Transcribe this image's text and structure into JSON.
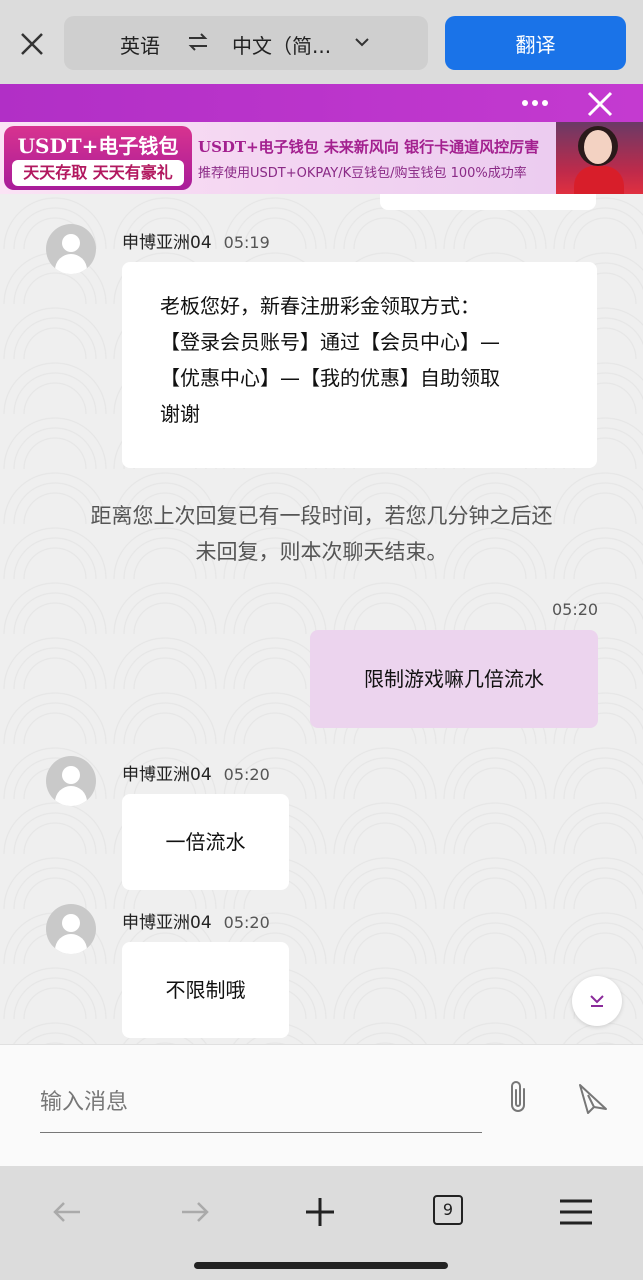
{
  "translate_bar": {
    "source_lang": "英语",
    "target_lang": "中文（简...",
    "translate_label": "翻译"
  },
  "banner": {
    "badge_title": "USDT+电子钱包",
    "badge_sub": "天天存取 天天有豪礼",
    "line1": "USDT+电子钱包 未来新风向 银行卡通道风控厉害",
    "line2": "推荐使用USDT+OKPAY/K豆钱包/购宝钱包 100%成功率"
  },
  "messages": [
    {
      "sender": "申博亚洲04",
      "time": "05:19",
      "lines": [
        "老板您好，新春注册彩金领取方式：",
        "【登录会员账号】通过【会员中心】—",
        "【优惠中心】—【我的优惠】自助领取",
        "谢谢"
      ]
    },
    {
      "sender": "申博亚洲04",
      "time": "05:20",
      "text": "一倍流水"
    },
    {
      "sender": "申博亚洲04",
      "time": "05:20",
      "text": "不限制哦"
    }
  ],
  "notice": {
    "line1": "距离您上次回复已有一段时间，若您几分钟之后还",
    "line2": "未回复，则本次聊天结束。"
  },
  "outgoing": {
    "time": "05:20",
    "text": "限制游戏嘛几倍流水"
  },
  "input": {
    "placeholder": "输入消息"
  },
  "browser": {
    "tab_count": "9"
  },
  "colors": {
    "header": "#c43ad0",
    "translate_button": "#1a73e8",
    "outgoing_bubble": "#ecd4ee"
  }
}
